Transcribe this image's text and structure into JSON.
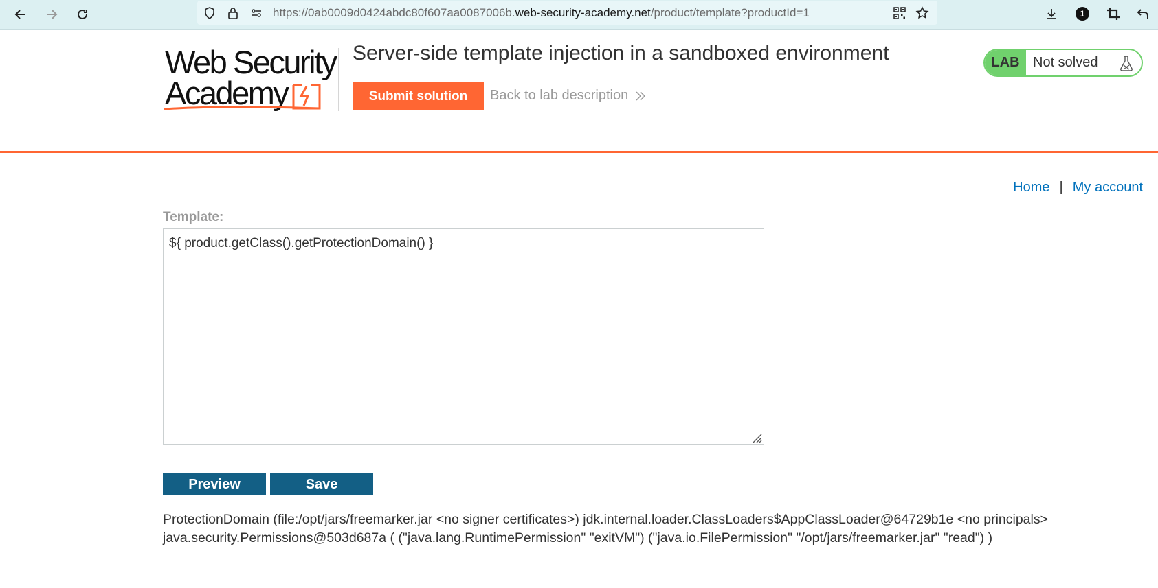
{
  "browser": {
    "url_prefix": "https://0ab0009d0424abdc80f607aa0087006b.",
    "url_host": "web-security-academy.net",
    "url_path": "/product/template?productId=1",
    "extensions_badge": "1"
  },
  "header": {
    "logo_line1": "Web Security",
    "logo_line2": "Academy",
    "lab_title": "Server-side template injection in a sandboxed environment",
    "submit_label": "Submit solution",
    "back_label": "Back to lab description",
    "status_tag": "LAB",
    "status_text": "Not solved"
  },
  "nav": {
    "home": "Home",
    "separator": "|",
    "account": "My account"
  },
  "editor": {
    "label": "Template:",
    "value": "${ product.getClass().getProtectionDomain() }",
    "preview_label": "Preview",
    "save_label": "Save"
  },
  "output": {
    "text": "ProtectionDomain (file:/opt/jars/freemarker.jar <no signer certificates>) jdk.internal.loader.ClassLoaders$AppClassLoader@64729b1e <no principals> java.security.Permissions@503d687a ( (\"java.lang.RuntimePermission\" \"exitVM\") (\"java.io.FilePermission\" \"/opt/jars/freemarker.jar\" \"read\") )"
  },
  "colors": {
    "brand_orange": "#ff6633",
    "lab_green": "#70d16d",
    "link_blue": "#0071bc",
    "button_blue": "#135f85"
  }
}
